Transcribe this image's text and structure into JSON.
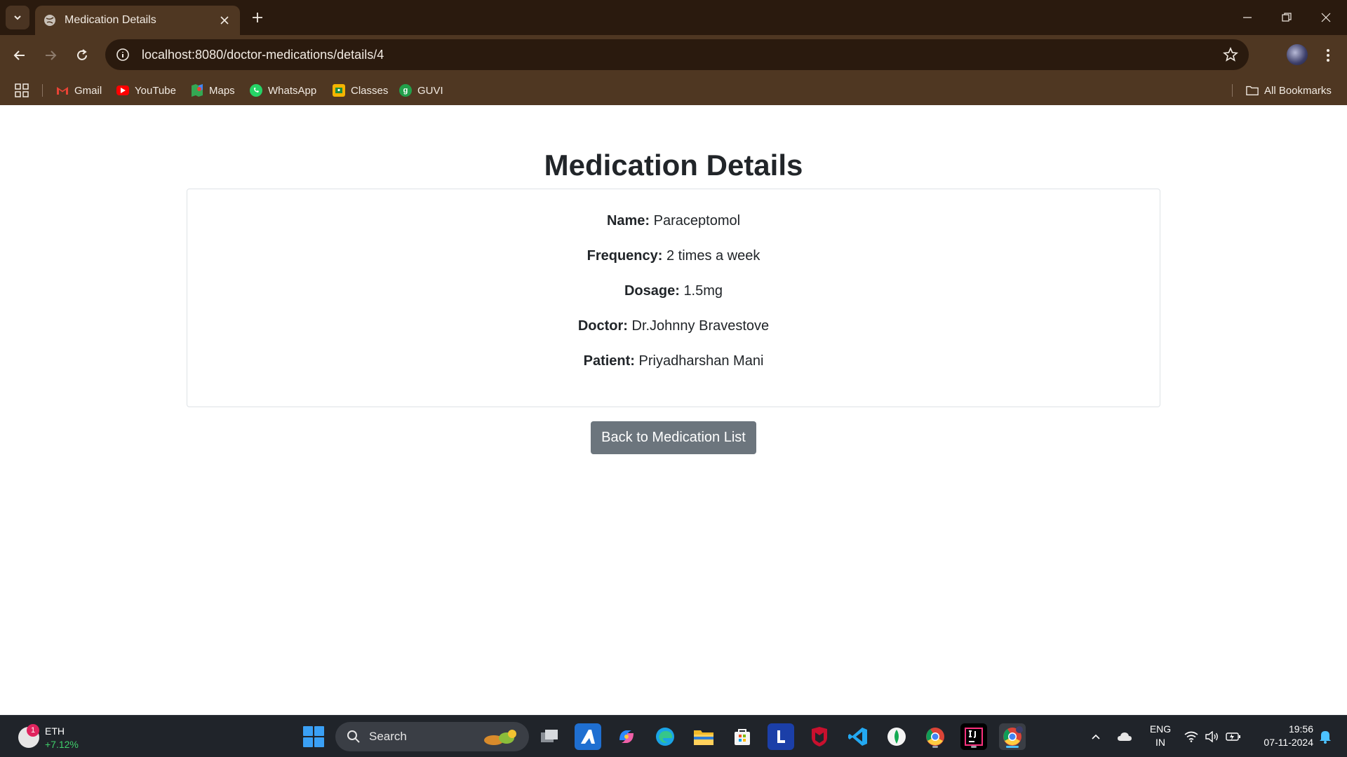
{
  "browser": {
    "tab_title": "Medication Details",
    "url": "localhost:8080/doctor-medications/details/4",
    "bookmarks": [
      {
        "label": "Gmail",
        "icon": "gmail-icon",
        "color": "#ea4335"
      },
      {
        "label": "YouTube",
        "icon": "youtube-icon",
        "color": "#ff0000"
      },
      {
        "label": "Maps",
        "icon": "maps-icon",
        "color": "#34a853"
      },
      {
        "label": "WhatsApp",
        "icon": "whatsapp-icon",
        "color": "#25d366"
      },
      {
        "label": "Classes",
        "icon": "classroom-icon",
        "color": "#f4b400"
      },
      {
        "label": "GUVI",
        "icon": "guvi-icon",
        "color": "#22a04b"
      }
    ],
    "all_bookmarks": "All Bookmarks"
  },
  "page": {
    "title": "Medication Details",
    "details": [
      {
        "label": "Name:",
        "value": "Paraceptomol"
      },
      {
        "label": "Frequency:",
        "value": "2 times a week"
      },
      {
        "label": "Dosage:",
        "value": "1.5mg"
      },
      {
        "label": "Doctor:",
        "value": "Dr.Johnny Bravestove"
      },
      {
        "label": "Patient:",
        "value": "Priyadharshan Mani"
      }
    ],
    "back_button": "Back to Medication List",
    "button_color": "#6c757d"
  },
  "taskbar": {
    "widget": {
      "title": "ETH",
      "change": "+7.12%",
      "badge": "1"
    },
    "search_label": "Search",
    "tray": {
      "lang_top": "ENG",
      "lang_bottom": "IN",
      "time": "19:56",
      "date": "07-11-2024"
    }
  }
}
